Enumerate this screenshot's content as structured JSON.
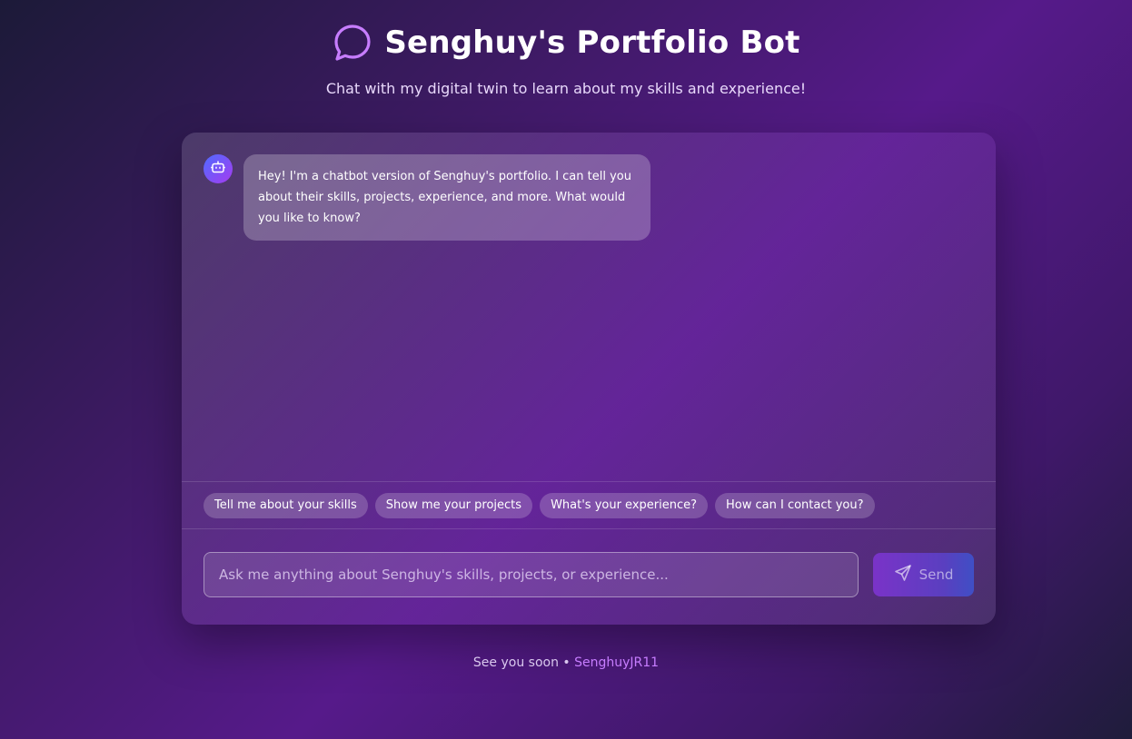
{
  "header": {
    "title": "Senghuy's Portfolio Bot",
    "subtitle": "Chat with my digital twin to learn about my skills and experience!",
    "title_icon": "chat-bubble-icon"
  },
  "chat": {
    "messages": [
      {
        "sender": "bot",
        "avatar_icon": "bot-icon",
        "text": "Hey! I'm a chatbot version of Senghuy's portfolio. I can tell you about their skills, projects, experience, and more. What would you like to know?"
      }
    ],
    "suggestions": [
      "Tell me about your skills",
      "Show me your projects",
      "What's your experience?",
      "How can I contact you?"
    ],
    "input": {
      "value": "",
      "placeholder": "Ask me anything about Senghuy's skills, projects, or experience..."
    },
    "send_button": {
      "label": "Send",
      "icon": "send-icon"
    }
  },
  "footer": {
    "text": "See you soon •",
    "link_text": "SenghuyJR11"
  },
  "colors": {
    "accent": "#c77dff",
    "avatar_gradient_start": "#4f6bff",
    "avatar_gradient_end": "#a53cf0"
  }
}
